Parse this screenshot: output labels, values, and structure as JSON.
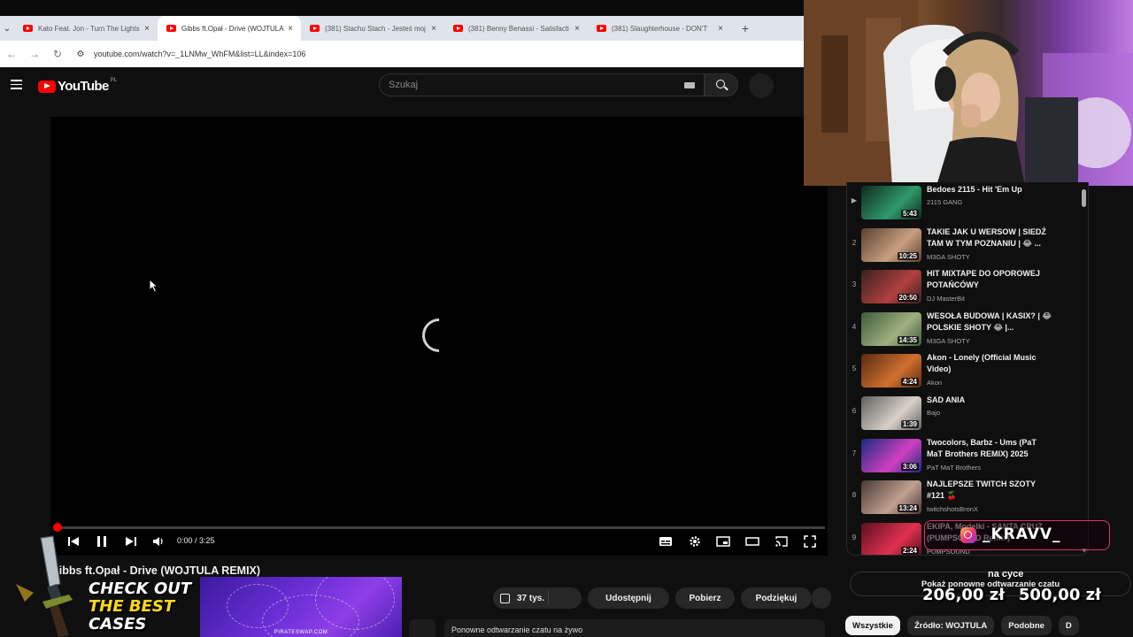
{
  "browser": {
    "tabs": [
      {
        "title": "Kato Feat. Jon - Turn The Lights",
        "active": false
      },
      {
        "title": "Gibbs ft.Opał - Drive (WOJTULA",
        "active": true
      },
      {
        "title": "(381) Stachu Stach - Jesteś moj",
        "active": false
      },
      {
        "title": "(381) Benny Benassi - Satisfacti",
        "active": false
      },
      {
        "title": "(381) Slaughterhouse - DON'T",
        "active": false
      }
    ],
    "new_tab": "+",
    "tab_list_chevron": "⌄",
    "back": "←",
    "forward": "→",
    "reload": "↻",
    "url": "youtube.com/watch?v=_1LNMw_WhFM&list=LL&index=106"
  },
  "header": {
    "logo_text": "YouTube",
    "country_code": "PL",
    "search_placeholder": "Szukaj"
  },
  "player": {
    "time_display": "0:00 / 3:25",
    "progress_fraction": 0.003
  },
  "video": {
    "title": "Gibbs ft.Opał - Drive (WOJTULA REMIX)",
    "likes": "37 tys.",
    "share_label": "Udostępnij",
    "download_label": "Pobierz",
    "thanks_label": "Podziękuj",
    "live_replay_label": "Ponowne odtwarzanie czatu na żywo"
  },
  "promo": {
    "line1": "CHECK OUT",
    "line2": "THE BEST",
    "line3": "CASES",
    "site": "PIRATESWAP.COM"
  },
  "playlist": {
    "items": [
      {
        "index": "▶",
        "title": "Bedoes 2115 - Hit 'Em Up",
        "channel": "2115 GANG",
        "duration": "5:43",
        "colors": [
          "#0f2a1e",
          "#2f9a6a"
        ]
      },
      {
        "index": "2",
        "title": "TAKIE JAK U WERSOW | SIEDŹ TAM W TYM POZNANIU | 😂 ...",
        "channel": "M3GA SHOTY",
        "duration": "10:25",
        "colors": [
          "#5a4030",
          "#c9a080"
        ]
      },
      {
        "index": "3",
        "title": "HIT MIXTAPE DO OPOROWEJ POTAŃCÓWY",
        "channel": "DJ MasterBit",
        "duration": "20:50",
        "colors": [
          "#3a2020",
          "#b04040"
        ]
      },
      {
        "index": "4",
        "title": "WESOŁA BUDOWA | KASIX? | 😂 POLSKIE SHOTY 😂 |...",
        "channel": "M3GA SHOTY",
        "duration": "14:35",
        "colors": [
          "#3c5a3a",
          "#a0b080"
        ]
      },
      {
        "index": "5",
        "title": "Akon - Lonely (Official Music Video)",
        "channel": "Akon",
        "duration": "4:24",
        "colors": [
          "#5a2a10",
          "#d07030"
        ]
      },
      {
        "index": "6",
        "title": "SAD ANIA",
        "channel": "Bajo",
        "duration": "1:39",
        "colors": [
          "#606060",
          "#d8d0c8"
        ]
      },
      {
        "index": "7",
        "title": "Twocolors, Barbz - Ums (PaT MaT Brothers REMIX) 2025",
        "channel": "PaT MaT Brothers",
        "duration": "3:06",
        "colors": [
          "#1a2a80",
          "#d040c0"
        ]
      },
      {
        "index": "8",
        "title": "NAJLEPSZE TWITCH SZOTY #121 🍒",
        "channel": "twitchshotsBronX",
        "duration": "13:24",
        "colors": [
          "#4a3a36",
          "#c0a090"
        ]
      },
      {
        "index": "9",
        "title": "EKIPA, Modelki - SANTA CRUZ (PUMPSOUND Remix)",
        "channel": "PUMPSOUND",
        "duration": "2:24",
        "colors": [
          "#5a1020",
          "#e03050"
        ]
      }
    ],
    "replay_chat_label": "Pokaż ponowne odtwarzanie czatu",
    "chips": [
      {
        "label": "Wszystkie",
        "active": true
      },
      {
        "label": "Źródło: WOJTULA",
        "active": false
      },
      {
        "label": "Podobne",
        "active": false
      },
      {
        "label": "D",
        "active": false
      }
    ]
  },
  "stream_overlay": {
    "social_handle": "_KRAVV_",
    "donation_caption": "na cyce",
    "donation_current": "206,00 zł",
    "donation_goal": "500,00 zł"
  },
  "colors": {
    "accent_red": "#ff0000",
    "background": "#0f0f0f",
    "overlay_pink": "#e0336a"
  }
}
